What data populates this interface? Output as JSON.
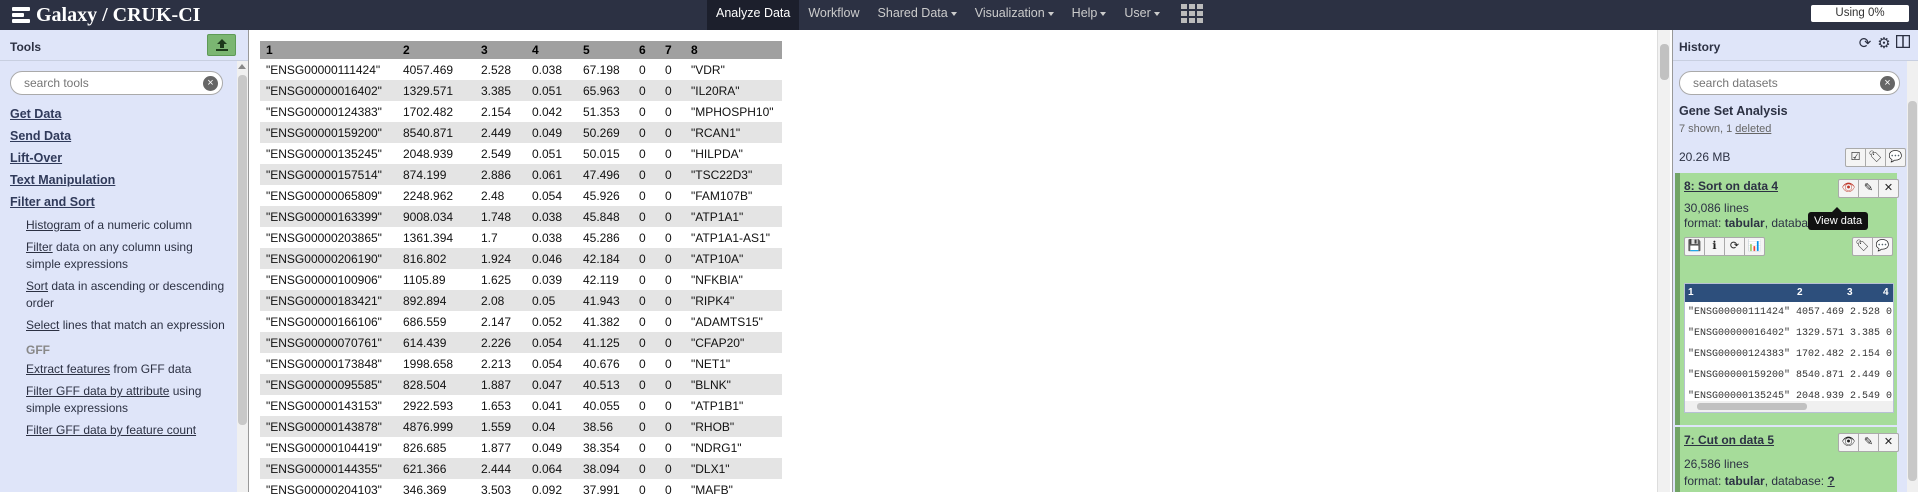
{
  "masthead": {
    "brand": "Galaxy / CRUK-CI",
    "nav": [
      {
        "label": "Analyze Data",
        "dropdown": false,
        "active": true
      },
      {
        "label": "Workflow",
        "dropdown": false
      },
      {
        "label": "Shared Data",
        "dropdown": true
      },
      {
        "label": "Visualization",
        "dropdown": true
      },
      {
        "label": "Help",
        "dropdown": true
      },
      {
        "label": "User",
        "dropdown": true
      }
    ],
    "apps_icon": "grid-icon",
    "quota": "Using 0%"
  },
  "tools": {
    "title": "Tools",
    "upload_icon": "upload-icon",
    "search_placeholder": "search tools",
    "sections": [
      "Get Data",
      "Send Data",
      "Lift-Over",
      "Text Manipulation",
      "Filter and Sort"
    ],
    "items": [
      {
        "link": "Histogram",
        "rest": " of a numeric column"
      },
      {
        "link": "Filter",
        "rest": " data on any column using simple expressions"
      },
      {
        "link": "Sort",
        "rest": " data in ascending or descending order"
      },
      {
        "link": "Select",
        "rest": " lines that match an expression"
      }
    ],
    "gff_label": "GFF",
    "gff_items": [
      {
        "link": "Extract features",
        "rest": " from GFF data"
      },
      {
        "link": "Filter GFF data by attribute",
        "rest": " using simple expressions"
      },
      {
        "link": "Filter GFF data by feature count",
        "rest": ""
      }
    ]
  },
  "table": {
    "columns": [
      "1",
      "2",
      "3",
      "4",
      "5",
      "6",
      "7",
      "8"
    ],
    "rows": [
      [
        "\"ENSG00000111424\"",
        "4057.469",
        "2.528",
        "0.038",
        "67.198",
        "0",
        "0",
        "\"VDR\""
      ],
      [
        "\"ENSG00000016402\"",
        "1329.571",
        "3.385",
        "0.051",
        "65.963",
        "0",
        "0",
        "\"IL20RA\""
      ],
      [
        "\"ENSG00000124383\"",
        "1702.482",
        "2.154",
        "0.042",
        "51.353",
        "0",
        "0",
        "\"MPHOSPH10\""
      ],
      [
        "\"ENSG00000159200\"",
        "8540.871",
        "2.449",
        "0.049",
        "50.269",
        "0",
        "0",
        "\"RCAN1\""
      ],
      [
        "\"ENSG00000135245\"",
        "2048.939",
        "2.549",
        "0.051",
        "50.015",
        "0",
        "0",
        "\"HILPDA\""
      ],
      [
        "\"ENSG00000157514\"",
        "874.199",
        "2.886",
        "0.061",
        "47.496",
        "0",
        "0",
        "\"TSC22D3\""
      ],
      [
        "\"ENSG00000065809\"",
        "2248.962",
        "2.48",
        "0.054",
        "45.926",
        "0",
        "0",
        "\"FAM107B\""
      ],
      [
        "\"ENSG00000163399\"",
        "9008.034",
        "1.748",
        "0.038",
        "45.848",
        "0",
        "0",
        "\"ATP1A1\""
      ],
      [
        "\"ENSG00000203865\"",
        "1361.394",
        "1.7",
        "0.038",
        "45.286",
        "0",
        "0",
        "\"ATP1A1-AS1\""
      ],
      [
        "\"ENSG00000206190\"",
        "816.802",
        "1.924",
        "0.046",
        "42.184",
        "0",
        "0",
        "\"ATP10A\""
      ],
      [
        "\"ENSG00000100906\"",
        "1105.89",
        "1.625",
        "0.039",
        "42.119",
        "0",
        "0",
        "\"NFKBIA\""
      ],
      [
        "\"ENSG00000183421\"",
        "892.894",
        "2.08",
        "0.05",
        "41.943",
        "0",
        "0",
        "\"RIPK4\""
      ],
      [
        "\"ENSG00000166106\"",
        "686.559",
        "2.147",
        "0.052",
        "41.382",
        "0",
        "0",
        "\"ADAMTS15\""
      ],
      [
        "\"ENSG00000070761\"",
        "614.439",
        "2.226",
        "0.054",
        "41.125",
        "0",
        "0",
        "\"CFAP20\""
      ],
      [
        "\"ENSG00000173848\"",
        "1998.658",
        "2.213",
        "0.054",
        "40.676",
        "0",
        "0",
        "\"NET1\""
      ],
      [
        "\"ENSG00000095585\"",
        "828.504",
        "1.887",
        "0.047",
        "40.513",
        "0",
        "0",
        "\"BLNK\""
      ],
      [
        "\"ENSG00000143153\"",
        "2922.593",
        "1.653",
        "0.041",
        "40.055",
        "0",
        "0",
        "\"ATP1B1\""
      ],
      [
        "\"ENSG00000143878\"",
        "4876.999",
        "1.559",
        "0.04",
        "38.56",
        "0",
        "0",
        "\"RHOB\""
      ],
      [
        "\"ENSG00000104419\"",
        "826.685",
        "1.877",
        "0.049",
        "38.354",
        "0",
        "0",
        "\"NDRG1\""
      ],
      [
        "\"ENSG00000144355\"",
        "621.366",
        "2.444",
        "0.064",
        "38.094",
        "0",
        "0",
        "\"DLX1\""
      ],
      [
        "\"ENSG00000204103\"",
        "346.369",
        "3.503",
        "0.092",
        "37.991",
        "0",
        "0",
        "\"MAFB\""
      ]
    ]
  },
  "history": {
    "title": "History",
    "icons": [
      "refresh-icon",
      "gear-icon",
      "columns-icon"
    ],
    "search_placeholder": "search datasets",
    "name": "Gene Set Analysis",
    "shown": "7 shown, 1 ",
    "deleted": "deleted",
    "size": "20.26 MB",
    "datasets": [
      {
        "title": "8: Sort on data 4",
        "lines": "30,086 lines",
        "format_label": "format: ",
        "format": "tabular",
        "db_label": ", database: ",
        "db": "?",
        "tooltip": "View data"
      },
      {
        "title": "7: Cut on data 5",
        "lines": "26,586 lines",
        "format_label": "format: ",
        "format": "tabular",
        "db_label": ", database: ",
        "db": "?"
      }
    ],
    "peek": {
      "columns": [
        "1",
        "2",
        "3",
        "4"
      ],
      "rows": [
        "\"ENSG00000111424\"  4057.469 2.528 0",
        "\"ENSG00000016402\"  1329.571 3.385 0",
        "\"ENSG00000124383\"  1702.482 2.154 0",
        "\"ENSG00000159200\"  8540.871 2.449 0",
        "\"ENSG00000135245\"  2048.939 2.549 0"
      ]
    }
  }
}
